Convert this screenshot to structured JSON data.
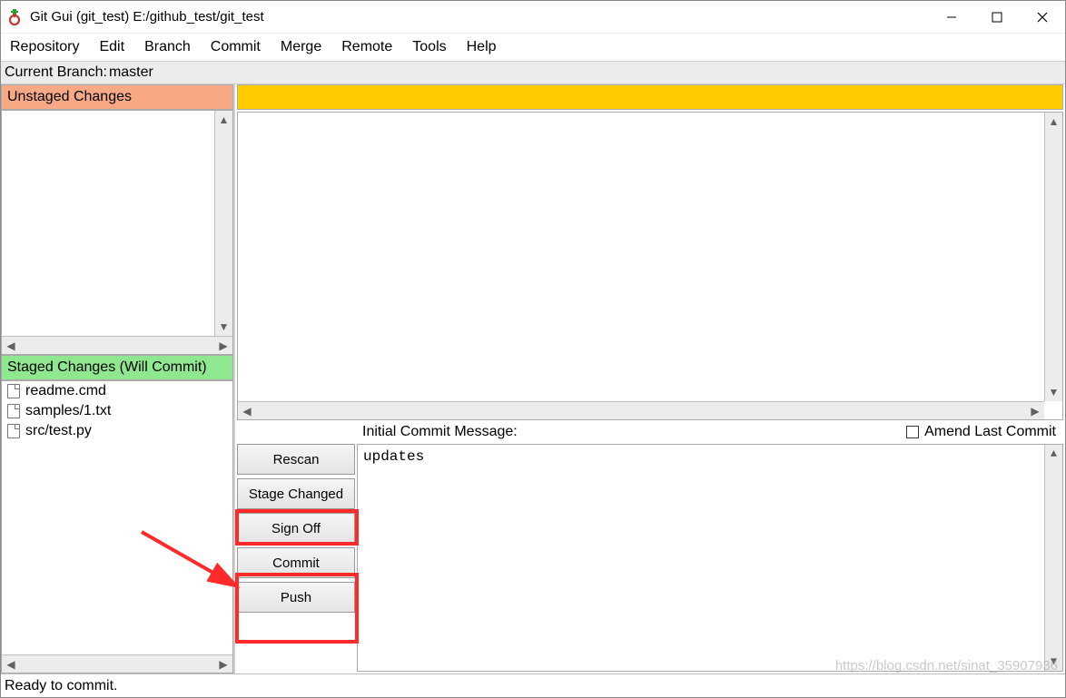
{
  "window": {
    "title": "Git Gui (git_test) E:/github_test/git_test"
  },
  "menu": {
    "items": [
      "Repository",
      "Edit",
      "Branch",
      "Commit",
      "Merge",
      "Remote",
      "Tools",
      "Help"
    ]
  },
  "branch": {
    "label": "Current Branch:",
    "name": "master"
  },
  "headers": {
    "unstaged": "Unstaged Changes",
    "staged": "Staged Changes (Will Commit)"
  },
  "staged_files": [
    "readme.cmd",
    "samples/1.txt",
    "src/test.py"
  ],
  "commit": {
    "label": "Initial Commit Message:",
    "amend_label": "Amend Last Commit",
    "message": "updates",
    "buttons": {
      "rescan": "Rescan",
      "stage_changed": "Stage Changed",
      "sign_off": "Sign Off",
      "commit": "Commit",
      "push": "Push"
    }
  },
  "status": {
    "text": "Ready to commit."
  },
  "watermark": "https://blog.csdn.net/sinat_35907936"
}
